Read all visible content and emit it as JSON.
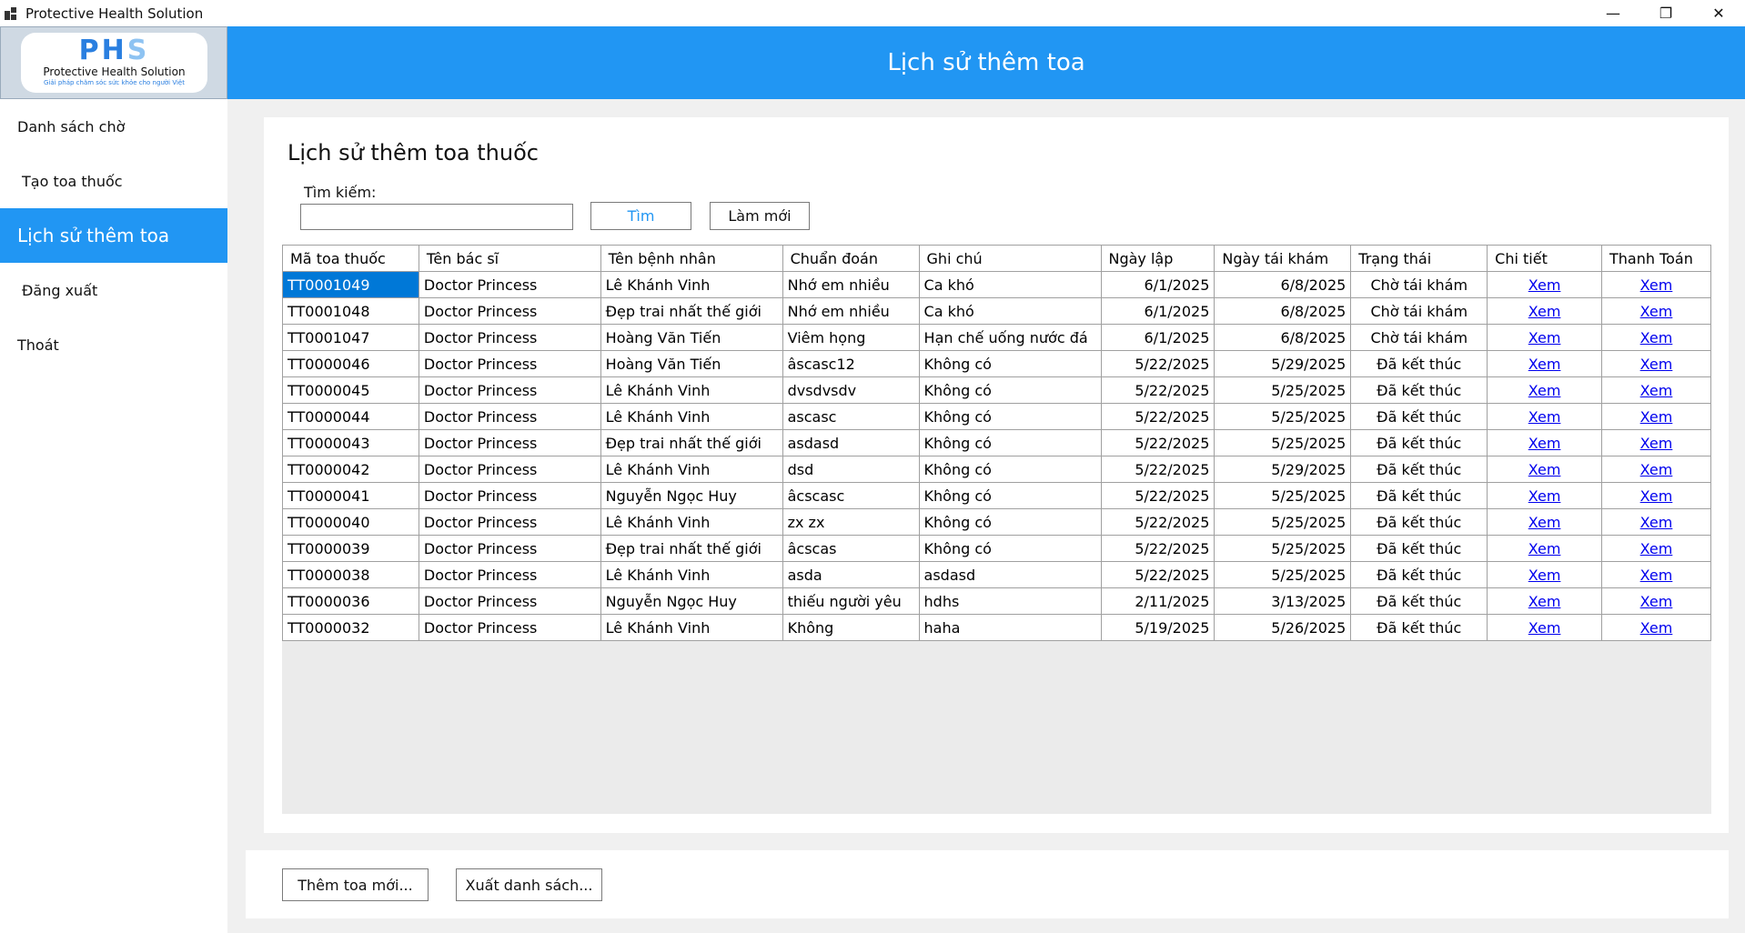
{
  "window": {
    "title": "Protective Health Solution",
    "minimize": "—",
    "restore": "❐",
    "close": "✕"
  },
  "logo": {
    "mark": "PH",
    "mark_s": "S",
    "name": "Protective Health Solution",
    "tagline": "Giải pháp chăm sóc sức khỏe cho người Việt"
  },
  "header": {
    "title": "Lịch sử thêm toa"
  },
  "sidebar": {
    "items": [
      {
        "label": "Danh sách chờ"
      },
      {
        "label": "Tạo toa thuốc"
      },
      {
        "label": "Lịch sử thêm toa"
      },
      {
        "label": "Đăng xuất"
      },
      {
        "label": "Thoát"
      }
    ]
  },
  "main": {
    "heading": "Lịch sử thêm toa thuốc",
    "search_label": "Tìm kiếm:",
    "search_value": "",
    "search_button": "Tìm",
    "refresh_button": "Làm mới"
  },
  "table": {
    "columns": [
      "Mã toa thuốc",
      "Tên bác sĩ",
      "Tên bệnh nhân",
      "Chuẩn đoán",
      "Ghi chú",
      "Ngày lập",
      "Ngày tái khám",
      "Trạng thái",
      "Chi tiết",
      "Thanh Toán"
    ],
    "rows": [
      [
        "TT0001049",
        "Doctor Princess",
        "Lê Khánh Vinh",
        "Nhớ em nhiều",
        "Ca khó",
        "6/1/2025",
        "6/8/2025",
        "Chờ tái khám",
        "Xem",
        "Xem"
      ],
      [
        "TT0001048",
        "Doctor Princess",
        "Đẹp trai nhất thế giới",
        "Nhớ em nhiều",
        "Ca khó",
        "6/1/2025",
        "6/8/2025",
        "Chờ tái khám",
        "Xem",
        "Xem"
      ],
      [
        "TT0001047",
        "Doctor Princess",
        "Hoàng Văn Tiến",
        "Viêm họng",
        "Hạn chế uống nước đá",
        "6/1/2025",
        "6/8/2025",
        "Chờ tái khám",
        "Xem",
        "Xem"
      ],
      [
        "TT0000046",
        "Doctor Princess",
        "Hoàng Văn Tiến",
        "âscasc12",
        "Không có",
        "5/22/2025",
        "5/29/2025",
        "Đã kết thúc",
        "Xem",
        "Xem"
      ],
      [
        "TT0000045",
        "Doctor Princess",
        "Lê Khánh Vinh",
        "dvsdvsdv",
        "Không có",
        "5/22/2025",
        "5/25/2025",
        "Đã kết thúc",
        "Xem",
        "Xem"
      ],
      [
        "TT0000044",
        "Doctor Princess",
        "Lê Khánh Vinh",
        "ascasc",
        "Không có",
        "5/22/2025",
        "5/25/2025",
        "Đã kết thúc",
        "Xem",
        "Xem"
      ],
      [
        "TT0000043",
        "Doctor Princess",
        "Đẹp trai nhất thế giới",
        "asdasd",
        "Không có",
        "5/22/2025",
        "5/25/2025",
        "Đã kết thúc",
        "Xem",
        "Xem"
      ],
      [
        "TT0000042",
        "Doctor Princess",
        "Lê Khánh Vinh",
        "dsd",
        "Không có",
        "5/22/2025",
        "5/29/2025",
        "Đã kết thúc",
        "Xem",
        "Xem"
      ],
      [
        "TT0000041",
        "Doctor Princess",
        "Nguyễn Ngọc Huy",
        "âcscasc",
        "Không có",
        "5/22/2025",
        "5/25/2025",
        "Đã kết thúc",
        "Xem",
        "Xem"
      ],
      [
        "TT0000040",
        "Doctor Princess",
        "Lê Khánh Vinh",
        "zx zx",
        "Không có",
        "5/22/2025",
        "5/25/2025",
        "Đã kết thúc",
        "Xem",
        "Xem"
      ],
      [
        "TT0000039",
        "Doctor Princess",
        "Đẹp trai nhất thế giới",
        "âcscas",
        "Không có",
        "5/22/2025",
        "5/25/2025",
        "Đã kết thúc",
        "Xem",
        "Xem"
      ],
      [
        "TT0000038",
        "Doctor Princess",
        "Lê Khánh Vinh",
        "asda",
        "asdasd",
        "5/22/2025",
        "5/25/2025",
        "Đã kết thúc",
        "Xem",
        "Xem"
      ],
      [
        "TT0000036",
        "Doctor Princess",
        "Nguyễn Ngọc Huy",
        "thiếu người yêu",
        "hdhs",
        "2/11/2025",
        "3/13/2025",
        "Đã kết thúc",
        "Xem",
        "Xem"
      ],
      [
        "TT0000032",
        "Doctor Princess",
        "Lê Khánh Vinh",
        "Không",
        "haha",
        "5/19/2025",
        "5/26/2025",
        "Đã kết thúc",
        "Xem",
        "Xem"
      ]
    ]
  },
  "footer": {
    "add_button": "Thêm toa mới...",
    "export_button": "Xuất danh sách..."
  },
  "colors": {
    "accent": "#2196f3",
    "selection": "#0078d7",
    "link": "#0000ee"
  },
  "icons": {
    "app": "app-icon",
    "minimize": "minimize-icon",
    "restore": "restore-icon",
    "close": "close-icon"
  }
}
